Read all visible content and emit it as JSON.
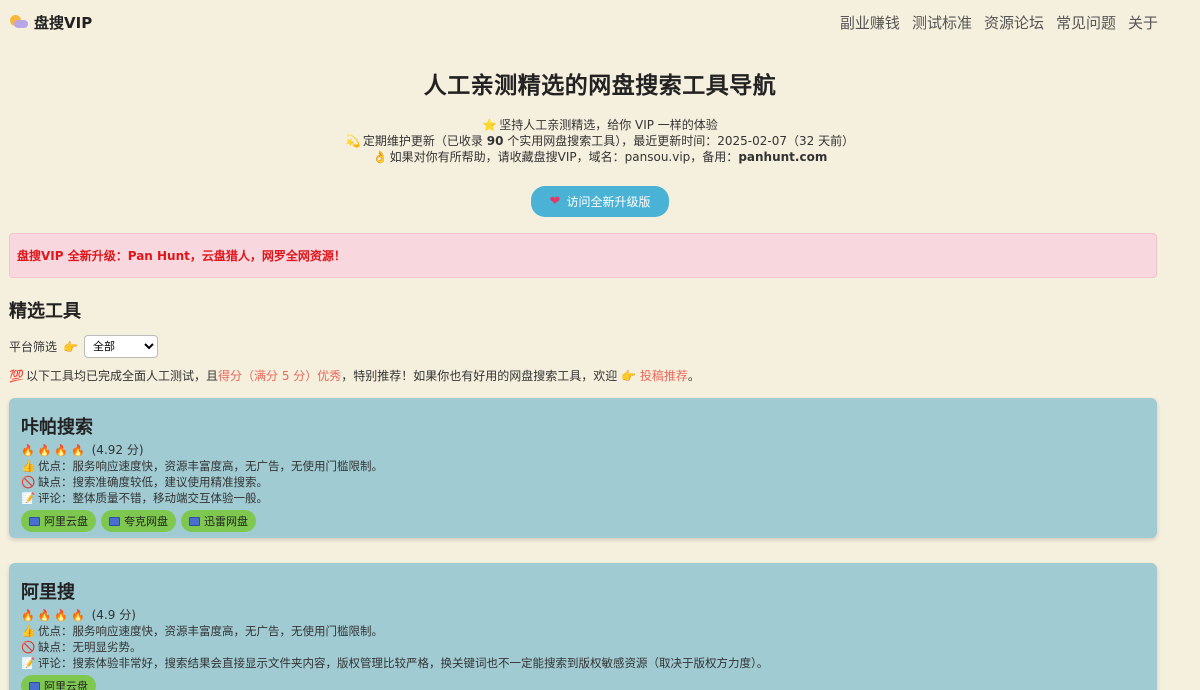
{
  "nav": {
    "brand": "盘搜VIP",
    "links": [
      "副业赚钱",
      "测试标准",
      "资源论坛",
      "常见问题",
      "关于"
    ]
  },
  "hero": {
    "title": "人工亲测精选的网盘搜索工具导航",
    "line1": "坚持人工亲测精选，给你 VIP 一样的体验",
    "line2_pre": "定期维护更新（已收录 ",
    "line2_count": "90",
    "line2_post": " 个实用网盘搜索工具），最近更新时间：2025-02-07（32 天前）",
    "line3_pre": "如果对你有所帮助，请收藏盘搜VIP，域名：pansou.vip，备用：",
    "line3_bold": "panhunt.com",
    "button": "访问全新升级版"
  },
  "alert": "盘搜VIP 全新升级：Pan Hunt，云盘猎人，网罗全网资源！",
  "section_title": "精选工具",
  "filter": {
    "label": "平台筛选",
    "selected": "全部"
  },
  "notice": {
    "pre": "以下工具均已完成全面人工测试，且",
    "red": "得分（满分 5 分）优秀",
    "mid": "，特别推荐！如果你也有好用的网盘搜索工具，欢迎",
    "link": "投稿推荐",
    "end": "。"
  },
  "tools": [
    {
      "name": "咔帕搜索",
      "score": "(4.92 分)",
      "pros": "优点：服务响应速度快，资源丰富度高，无广告，无使用门槛限制。",
      "cons": "缺点：搜索准确度较低，建议使用精准搜索。",
      "review": "评论：整体质量不错，移动端交互体验一般。",
      "tags": [
        "阿里云盘",
        "夸克网盘",
        "迅雷网盘"
      ]
    },
    {
      "name": "阿里搜",
      "score": "(4.9 分)",
      "pros": "优点：服务响应速度快，资源丰富度高，无广告，无使用门槛限制。",
      "cons": "缺点：无明显劣势。",
      "review": "评论：搜索体验非常好，搜索结果会直接显示文件夹内容，版权管理比较严格，换关键词也不一定能搜索到版权敏感资源（取决于版权方力度）。",
      "tags": [
        "阿里云盘"
      ]
    }
  ],
  "colors": {
    "background": "#f5efdd",
    "card": "#a0cbd2",
    "tag": "#7fc84f",
    "button": "#4ab2d4",
    "alert_bg": "#f8d7de",
    "alert_text": "#e0161a"
  }
}
